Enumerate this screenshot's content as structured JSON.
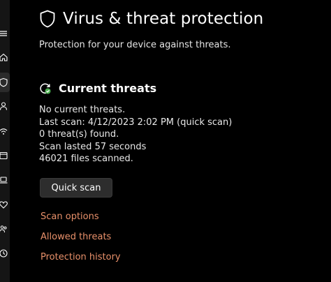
{
  "header": {
    "title": "Virus & threat protection",
    "subtitle": "Protection for your device against threats.",
    "icon": "shield-icon"
  },
  "current_threats": {
    "title": "Current threats",
    "icon": "refresh-check-icon",
    "status": "No current threats.",
    "last_scan": "Last scan: 4/12/2023 2:02 PM (quick scan)",
    "threats_found": "0 threat(s) found.",
    "scan_duration": "Scan lasted 57 seconds",
    "files_scanned": "46021 files scanned."
  },
  "actions": {
    "quick_scan_label": "Quick scan"
  },
  "links": {
    "scan_options": "Scan options",
    "allowed_threats": "Allowed threats",
    "protection_history": "Protection history"
  },
  "sidebar": {
    "items": [
      {
        "icon": "menu-icon"
      },
      {
        "icon": "home-icon"
      },
      {
        "icon": "shield-icon",
        "active": true
      },
      {
        "icon": "person-icon"
      },
      {
        "icon": "wifi-icon"
      },
      {
        "icon": "app-browser-icon"
      },
      {
        "icon": "laptop-icon"
      },
      {
        "icon": "heart-icon"
      },
      {
        "icon": "family-icon"
      },
      {
        "icon": "history-icon"
      }
    ]
  },
  "colors": {
    "background": "#000000",
    "sidebar": "#151515",
    "link": "#e8906a",
    "button": "#2d2d2d",
    "success_badge": "#4caf50"
  }
}
